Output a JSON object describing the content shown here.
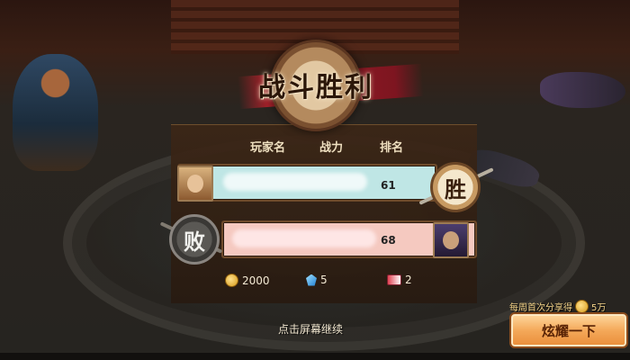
{
  "banner": {
    "title": "战斗胜利"
  },
  "table": {
    "headers": {
      "name": "玩家名",
      "power": "战力",
      "rank": "排名"
    },
    "rows": [
      {
        "result": "胜",
        "power": "61"
      },
      {
        "result": "败",
        "power": "68"
      }
    ]
  },
  "rewards": [
    {
      "icon": "gold-coin-icon",
      "value": "2000"
    },
    {
      "icon": "gem-icon",
      "value": "5"
    },
    {
      "icon": "ticket-icon",
      "value": "2"
    }
  ],
  "footer": {
    "continue_text": "点击屏幕继续"
  },
  "share": {
    "weekly_text": "每周首次分享得",
    "weekly_reward": "5万",
    "button_label": "炫耀一下"
  },
  "colors": {
    "win_row": "#bfe6e5",
    "lose_row": "#f5c9c0",
    "button": "#f4a95a"
  }
}
